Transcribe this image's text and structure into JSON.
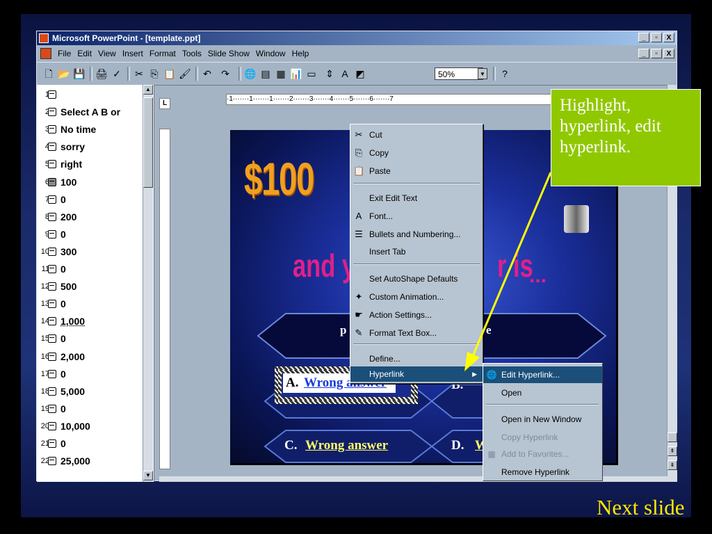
{
  "window": {
    "title": "Microsoft PowerPoint - [template.ppt]",
    "buttons": [
      "_",
      "▫",
      "X"
    ]
  },
  "menu": {
    "items": [
      "File",
      "Edit",
      "View",
      "Insert",
      "Format",
      "Tools",
      "Slide Show",
      "Window",
      "Help"
    ]
  },
  "toolbar": {
    "zoom": "50%"
  },
  "outline": {
    "rows": [
      {
        "n": "1",
        "text": ""
      },
      {
        "n": "2",
        "text": "Select  A  B or"
      },
      {
        "n": "3",
        "text": "No time"
      },
      {
        "n": "4",
        "text": "sorry"
      },
      {
        "n": "5",
        "text": "right"
      },
      {
        "n": "6",
        "text": "100"
      },
      {
        "n": "7",
        "text": "0"
      },
      {
        "n": "8",
        "text": "200"
      },
      {
        "n": "9",
        "text": "0"
      },
      {
        "n": "10",
        "text": "300"
      },
      {
        "n": "11",
        "text": "0"
      },
      {
        "n": "12",
        "text": "500"
      },
      {
        "n": "13",
        "text": "0"
      },
      {
        "n": "14",
        "text": "1,000"
      },
      {
        "n": "15",
        "text": "0"
      },
      {
        "n": "16",
        "text": "2,000"
      },
      {
        "n": "17",
        "text": "0"
      },
      {
        "n": "18",
        "text": "5,000"
      },
      {
        "n": "19",
        "text": "0"
      },
      {
        "n": "20",
        "text": "10,000"
      },
      {
        "n": "21",
        "text": "0"
      },
      {
        "n": "22",
        "text": "25,000"
      }
    ]
  },
  "ruler": {
    "h_ticks": "·1·······1·······1·······2·······3·······4·······5·······6·······7",
    "corner": "L"
  },
  "slide": {
    "amount": "$100",
    "phrase_left": "and y",
    "phrase_right": "r is",
    "dots": "...",
    "partial_q_left": "p",
    "partial_q_right": "e",
    "ans_a_letter": "A.",
    "ans_a_text": "Wrong answer",
    "ans_b_letter": "B.",
    "ans_c_letter": "C.",
    "ans_c_text": "Wrong answer",
    "ans_d_letter": "D.",
    "ans_d_partial": "W"
  },
  "context_menu": {
    "items": [
      {
        "label": "Cut",
        "icon": "✂"
      },
      {
        "label": "Copy",
        "icon": "⎘"
      },
      {
        "label": "Paste",
        "icon": "📋"
      },
      {
        "label": "Exit Edit Text",
        "icon": ""
      },
      {
        "label": "Font...",
        "icon": "A"
      },
      {
        "label": "Bullets and Numbering...",
        "icon": "☰"
      },
      {
        "label": "Insert Tab",
        "icon": ""
      },
      {
        "label": "Set AutoShape Defaults",
        "icon": ""
      },
      {
        "label": "Custom Animation...",
        "icon": "✦"
      },
      {
        "label": "Action Settings...",
        "icon": "☛"
      },
      {
        "label": "Format Text Box...",
        "icon": "✎"
      },
      {
        "label": "Define...",
        "icon": ""
      },
      {
        "label": "Hyperlink",
        "icon": ""
      }
    ]
  },
  "submenu": {
    "items": [
      {
        "label": "Edit Hyperlink...",
        "icon": "🌐"
      },
      {
        "label": "Open",
        "icon": ""
      },
      {
        "label": "Open in New Window",
        "icon": ""
      },
      {
        "label": "Copy Hyperlink",
        "icon": ""
      },
      {
        "label": "Add to Favorites...",
        "icon": "▦"
      },
      {
        "label": "Remove Hyperlink",
        "icon": ""
      }
    ]
  },
  "callout": {
    "text": "Highlight, hyperlink, edit hyperlink."
  },
  "footer": {
    "next": "Next slide"
  },
  "colors": {
    "callout_bg": "#90c800",
    "next_text": "#ffe800",
    "arrow": "#ffff00",
    "menu_highlight": "#1b4f7a"
  }
}
